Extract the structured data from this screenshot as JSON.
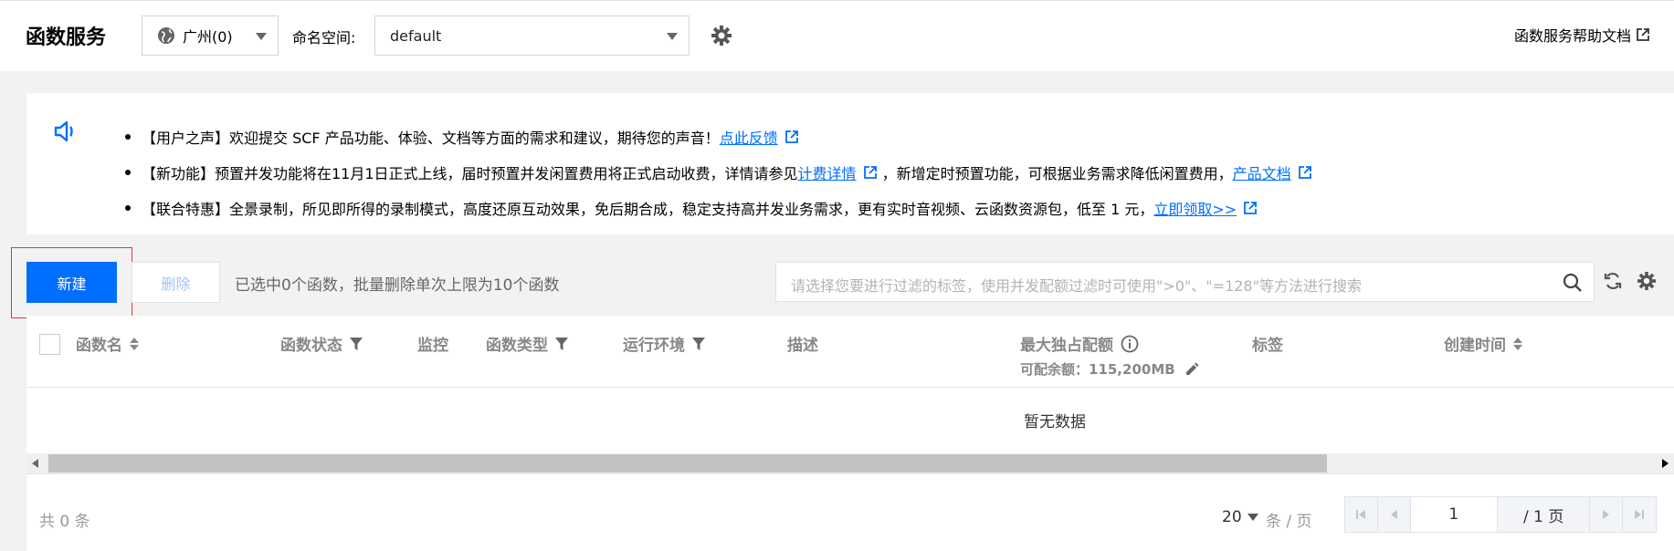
{
  "header": {
    "title": "函数服务",
    "region": "广州(0)",
    "namespace_label": "命名空间:",
    "namespace_value": "default",
    "help_link": "函数服务帮助文档"
  },
  "notices": [
    {
      "text": "【用户之声】欢迎提交 SCF 产品功能、体验、文档等方面的需求和建议，期待您的声音！",
      "link": "点此反馈"
    },
    {
      "text": "【新功能】预置并发功能将在11月1日正式上线，届时预置并发闲置费用将正式启动收费，详情请参见",
      "link": "计费详情",
      "text2": "，新增定时预置功能，可根据业务需求降低闲置费用，",
      "link2": "产品文档"
    },
    {
      "text": "【联合特惠】全景录制，所见即所得的录制模式，高度还原互动效果，免后期合成，稳定支持高并发业务需求，更有实时音视频、云函数资源包，低至 1 元，",
      "link": "立即领取>>"
    }
  ],
  "toolbar": {
    "create_label": "新建",
    "delete_label": "删除",
    "selected_info": "已选中0个函数，批量删除单次上限为10个函数",
    "search_placeholder": "请选择您要进行过滤的标签，使用并发配额过滤时可使用\">0\"、\"=128\"等方法进行搜索"
  },
  "table": {
    "columns": [
      "函数名",
      "函数状态",
      "监控",
      "函数类型",
      "运行环境",
      "描述",
      "最大独占配额",
      "标签",
      "创建时间"
    ],
    "quota_sub": "可配余额：115,200MB",
    "empty_text": "暂无数据"
  },
  "pagination": {
    "total": "共 0 条",
    "page_size": "20",
    "per_page": "条 / 页",
    "current_page": "1",
    "total_pages": "/ 1 页"
  },
  "colors": {
    "primary": "#006eff",
    "link": "#006eff"
  }
}
